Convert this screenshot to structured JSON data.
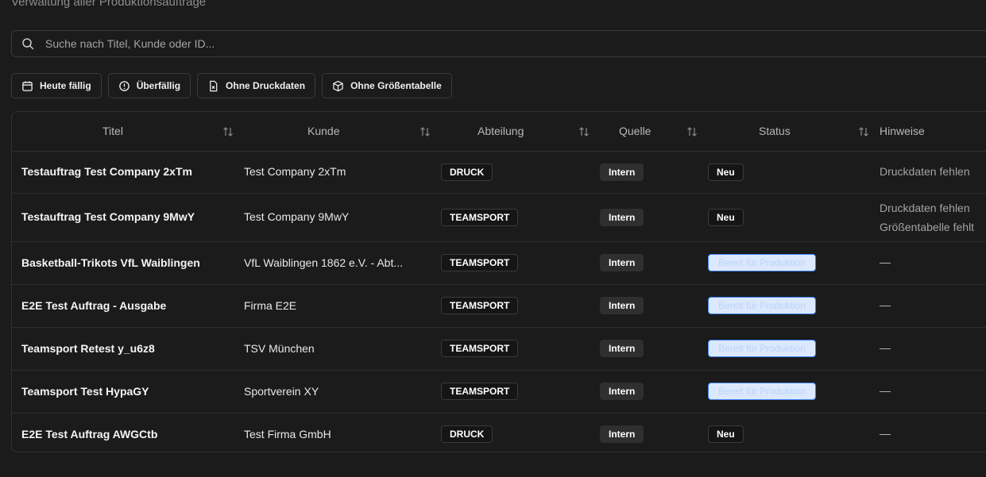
{
  "header": {
    "subtitle": "Verwaltung aller Produktionsaufträge"
  },
  "search": {
    "placeholder": "Suche nach Titel, Kunde oder ID..."
  },
  "filters": [
    {
      "label": "Heute fällig",
      "icon": "calendar-icon"
    },
    {
      "label": "Überfällig",
      "icon": "alert-circle-icon"
    },
    {
      "label": "Ohne Druckdaten",
      "icon": "file-x-icon"
    },
    {
      "label": "Ohne Größentabelle",
      "icon": "box-icon"
    }
  ],
  "table": {
    "columns": [
      "Titel",
      "Kunde",
      "Abteilung",
      "Quelle",
      "Status",
      "Hinweise"
    ],
    "rows": [
      {
        "titel": "Testauftrag Test Company 2xTm",
        "kunde": "Test Company 2xTm",
        "abteilung": "DRUCK",
        "quelle": "Intern",
        "status": "Neu",
        "hinweise": [
          "Druckdaten fehlen"
        ]
      },
      {
        "titel": "Testauftrag Test Company 9MwY",
        "kunde": "Test Company 9MwY",
        "abteilung": "TEAMSPORT",
        "quelle": "Intern",
        "status": "Neu",
        "hinweise": [
          "Druckdaten fehlen",
          "Größentabelle fehlt"
        ]
      },
      {
        "titel": "Basketball-Trikots VfL Waiblingen",
        "kunde": "VfL Waiblingen 1862 e.V. - Abt...",
        "abteilung": "TEAMSPORT",
        "quelle": "Intern",
        "status": "Bereit für Produktion",
        "hinweise": [
          "—"
        ]
      },
      {
        "titel": "E2E Test Auftrag - Ausgabe",
        "kunde": "Firma E2E",
        "abteilung": "TEAMSPORT",
        "quelle": "Intern",
        "status": "Bereit für Produktion",
        "hinweise": [
          "—"
        ]
      },
      {
        "titel": "Teamsport Retest y_u6z8",
        "kunde": "TSV München",
        "abteilung": "TEAMSPORT",
        "quelle": "Intern",
        "status": "Bereit für Produktion",
        "hinweise": [
          "—"
        ]
      },
      {
        "titel": "Teamsport Test HypaGY",
        "kunde": "Sportverein XY",
        "abteilung": "TEAMSPORT",
        "quelle": "Intern",
        "status": "Bereit für Produktion",
        "hinweise": [
          "—"
        ]
      },
      {
        "titel": "E2E Test Auftrag AWGCtb",
        "kunde": "Test Firma GmbH",
        "abteilung": "DRUCK",
        "quelle": "Intern",
        "status": "Neu",
        "hinweise": [
          "—"
        ]
      }
    ]
  }
}
